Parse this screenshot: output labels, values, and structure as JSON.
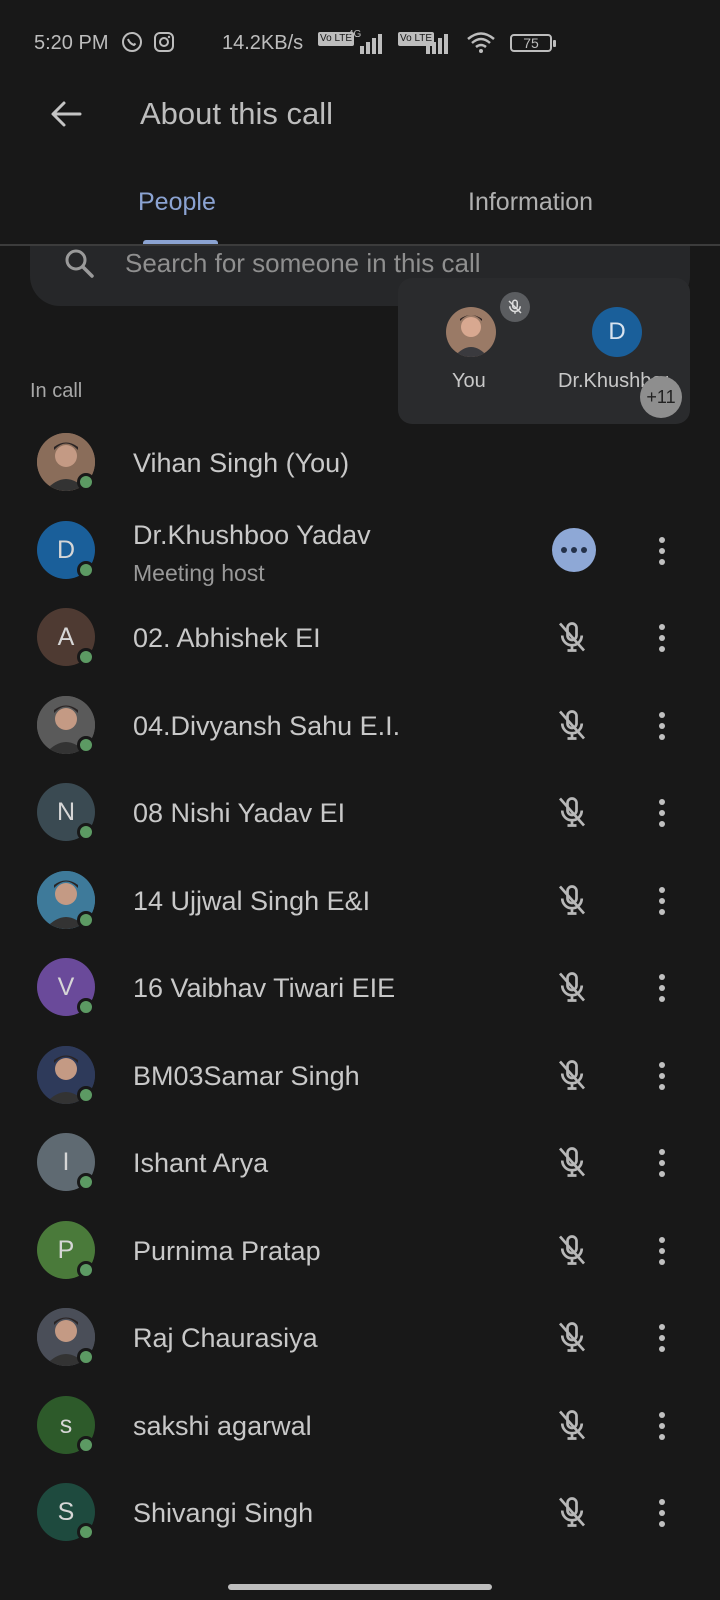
{
  "status_bar": {
    "time": "5:20 PM",
    "speed": "14.2KB/s",
    "battery": "75",
    "net_tag_1": "4G",
    "volte_tag": "Vo LTE"
  },
  "header": {
    "title": "About this call",
    "back_icon": "arrow-back-icon"
  },
  "tabs": [
    {
      "label": "People",
      "active": true
    },
    {
      "label": "Information",
      "active": false
    }
  ],
  "search": {
    "placeholder": "Search for someone in this call"
  },
  "preview": {
    "you_label": "You",
    "host_initial": "D",
    "host_label": "Dr.Khushboo",
    "more_count": "+11"
  },
  "section_label": "In call",
  "participants": [
    {
      "name": "Vihan Singh (You)",
      "initial": "",
      "avatar_color": "#8a6d5a",
      "photo": true
    },
    {
      "name": "Dr.Khushboo Yadav",
      "sub": "Meeting host",
      "initial": "D",
      "avatar_color": "#1a5f9a"
    },
    {
      "name": "02. Abhishek EI",
      "initial": "A",
      "avatar_color": "#4e3a32"
    },
    {
      "name": "04.Divyansh Sahu E.I.",
      "initial": "",
      "avatar_color": "#5a5a5a",
      "photo": true
    },
    {
      "name": "08 Nishi Yadav EI",
      "initial": "N",
      "avatar_color": "#3a4a52"
    },
    {
      "name": "14 Ujjwal Singh E&I",
      "initial": "",
      "avatar_color": "#3e7a9a",
      "photo": true
    },
    {
      "name": "16 Vaibhav Tiwari EIE",
      "initial": "V",
      "avatar_color": "#6a4a9a"
    },
    {
      "name": "BM03Samar Singh",
      "initial": "",
      "avatar_color": "#2e3a5a",
      "photo": true
    },
    {
      "name": "Ishant Arya",
      "initial": "I",
      "avatar_color": "#5f6a72"
    },
    {
      "name": "Purnima Pratap",
      "initial": "P",
      "avatar_color": "#4a7a3a"
    },
    {
      "name": "Raj Chaurasiya",
      "initial": "",
      "avatar_color": "#4a4e58",
      "photo": true
    },
    {
      "name": "sakshi agarwal",
      "initial": "s",
      "avatar_color": "#2d5a2a"
    },
    {
      "name": "Shivangi Singh",
      "initial": "S",
      "avatar_color": "#1e4a3e"
    }
  ],
  "colors": {
    "background": "#181818",
    "accent": "#8ba3d2",
    "online": "#5c9a63"
  }
}
